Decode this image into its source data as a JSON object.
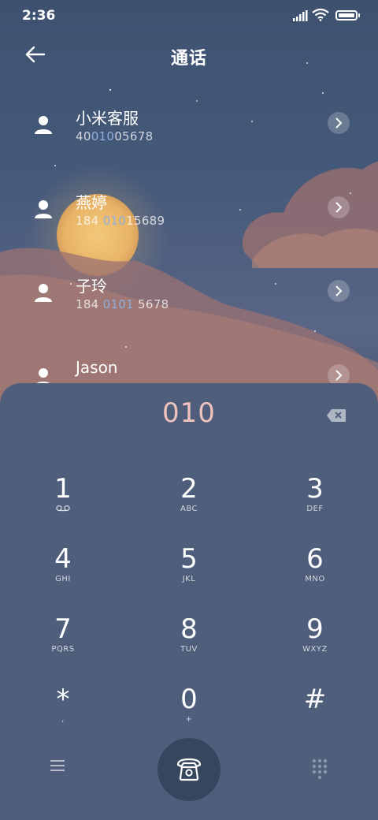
{
  "status_bar": {
    "time": "2:36"
  },
  "header": {
    "title": "通话"
  },
  "contacts": [
    {
      "name": "小米客服",
      "number_pre": "40",
      "number_hl": "010",
      "number_post": "05678"
    },
    {
      "name": "燕婷",
      "number_pre": "184 ",
      "number_hl": "010",
      "number_post": "15689"
    },
    {
      "name": "子玲",
      "number_pre": "184 ",
      "number_hl": "0101",
      "number_post": " 5678"
    },
    {
      "name": "Jason",
      "number_pre": "",
      "number_hl": "",
      "number_post": ""
    }
  ],
  "dialpad": {
    "input_value": "010",
    "keys": [
      {
        "digit": "1",
        "letters": ""
      },
      {
        "digit": "2",
        "letters": "ABC"
      },
      {
        "digit": "3",
        "letters": "DEF"
      },
      {
        "digit": "4",
        "letters": "GHI"
      },
      {
        "digit": "5",
        "letters": "JKL"
      },
      {
        "digit": "6",
        "letters": "MNO"
      },
      {
        "digit": "7",
        "letters": "PQRS"
      },
      {
        "digit": "8",
        "letters": "TUV"
      },
      {
        "digit": "9",
        "letters": "WXYZ"
      },
      {
        "digit": "*",
        "letters": ","
      },
      {
        "digit": "0",
        "letters": "+"
      },
      {
        "digit": "#",
        "letters": ""
      }
    ]
  },
  "icons": {
    "back": "back-arrow-icon",
    "avatar": "person-icon",
    "chevron": "chevron-right-icon",
    "delete": "backspace-icon",
    "voicemail": "voicemail-icon",
    "menu": "menu-icon",
    "call": "phone-icon",
    "dialpad_toggle": "dialpad-icon"
  },
  "colors": {
    "input_text": "#efc2bd",
    "number_highlight": "#8fb0dd",
    "pad_bg": "#4e5e7b",
    "call_button": "#37465f"
  }
}
